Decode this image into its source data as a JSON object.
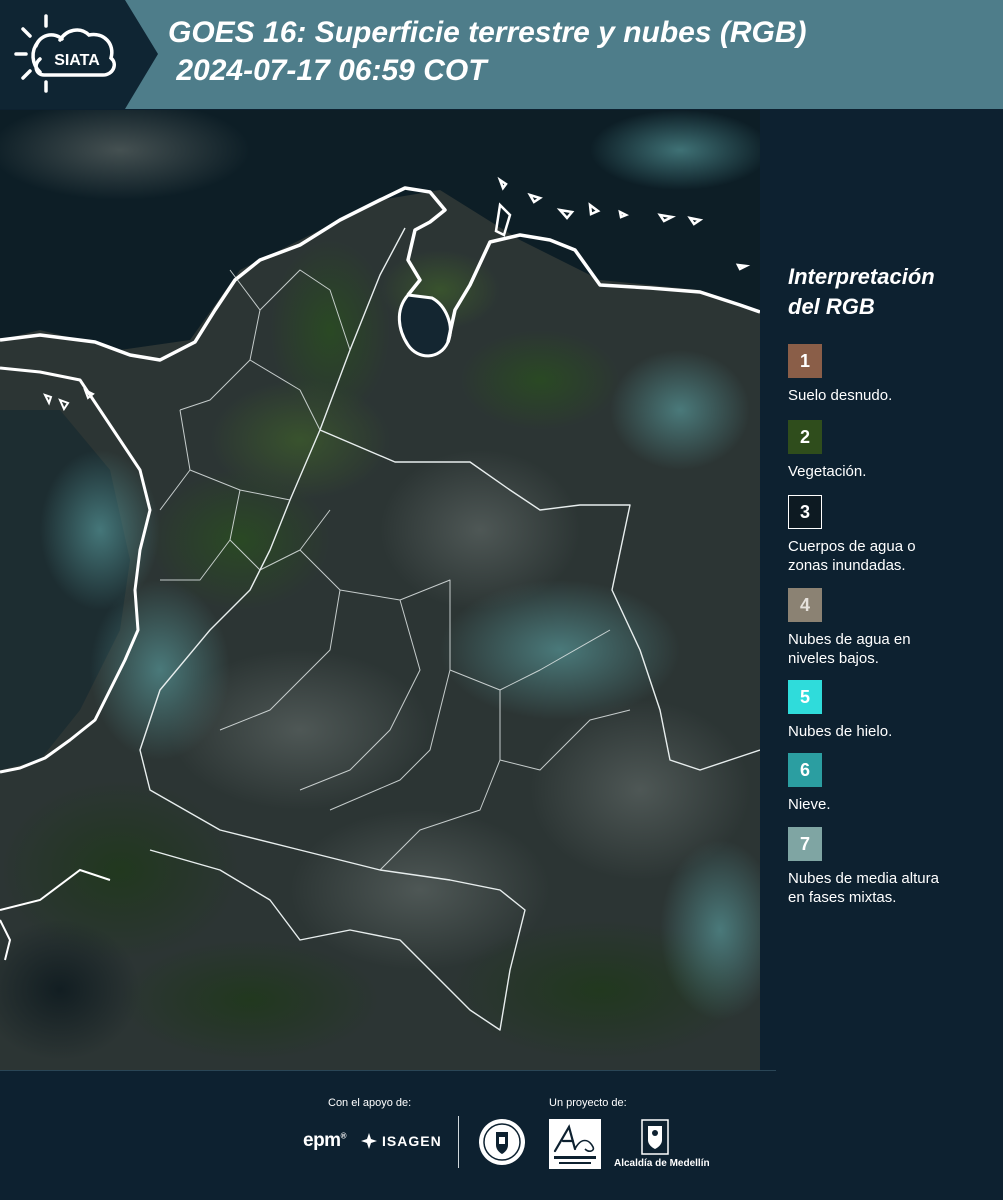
{
  "header": {
    "logo_text": "SIATA",
    "title": "GOES 16: Superficie terrestre y nubes (RGB)\n 2024-07-17 06:59 COT"
  },
  "legend": {
    "title": "Interpretación\ndel RGB",
    "items": [
      {
        "number": "1",
        "label": "Suelo desnudo.",
        "color": "#8a5e48"
      },
      {
        "number": "2",
        "label": "Vegetación.",
        "color": "#2f4d1c"
      },
      {
        "number": "3",
        "label": "Cuerpos de agua o\nzonas inundadas.",
        "color": "#0d1a22"
      },
      {
        "number": "4",
        "label": "Nubes de agua en\nniveles bajos.",
        "color": "#8b8273"
      },
      {
        "number": "5",
        "label": "Nubes de hielo.",
        "color": "#2fdcdb"
      },
      {
        "number": "6",
        "label": "Nieve.",
        "color": "#2b9ea1"
      },
      {
        "number": "7",
        "label": "Nubes de media altura\nen fases mixtas.",
        "color": "#7fa5a3"
      }
    ]
  },
  "footer": {
    "support_label": "Con el apoyo de:",
    "project_label": "Un proyecto de:",
    "epm_label": "epm",
    "isagen_label": "ISAGEN",
    "alcaldia_label": "Alcaldía de Medellín"
  }
}
